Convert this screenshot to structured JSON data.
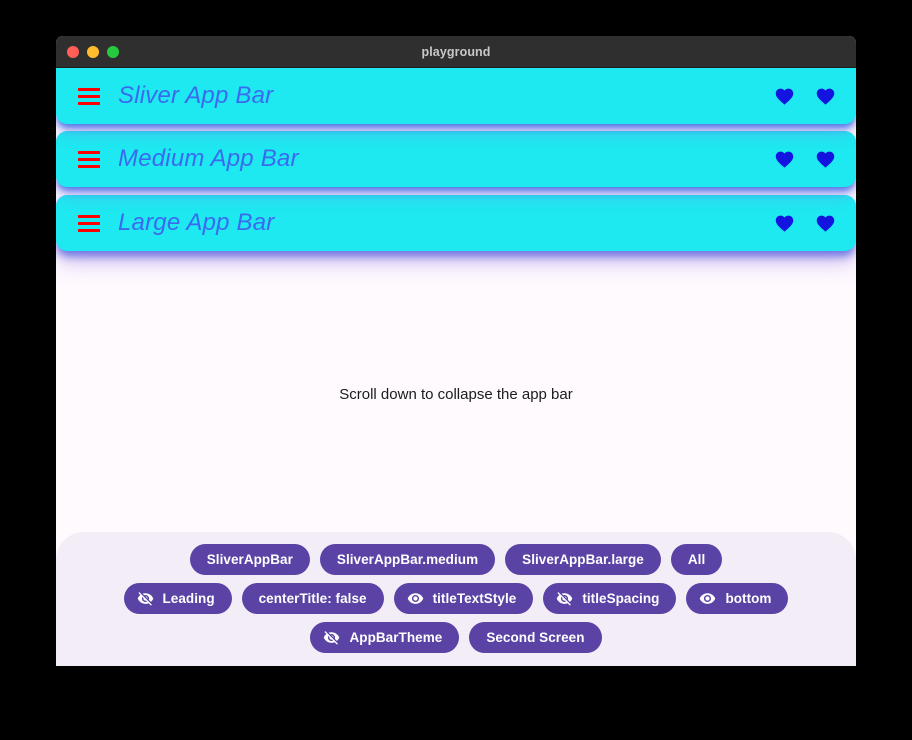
{
  "window": {
    "title": "playground",
    "traffic_lights": [
      "close-button",
      "minimize-button",
      "maximize-button"
    ],
    "colors": {
      "titlebar_bg": "#2F2F2F",
      "title_text": "#C9C9C9",
      "close": "#FF5F56",
      "minimize": "#FFBD2E",
      "maximize": "#27C93F"
    }
  },
  "appbars": [
    {
      "title": "Sliver App Bar",
      "leading_icon": "menu-icon",
      "actions": [
        "favorite-icon",
        "favorite-icon"
      ]
    },
    {
      "title": "Medium App Bar",
      "leading_icon": "menu-icon",
      "actions": [
        "favorite-icon",
        "favorite-icon"
      ]
    },
    {
      "title": "Large App Bar",
      "leading_icon": "menu-icon",
      "actions": [
        "favorite-icon",
        "favorite-icon"
      ]
    }
  ],
  "appbar_colors": {
    "background": "#1EE8F0",
    "title_text": "#3A6AF0",
    "leading_icon": "#FF0000",
    "action_icon": "#1414E0",
    "shadow": "#3A5AE6"
  },
  "body": {
    "hint": "Scroll down to collapse the app bar",
    "background": "#FEFAFE"
  },
  "controls": {
    "background": "#F3EDF7",
    "chip_background": "#5A43A5",
    "chip_text": "#FFFFFF",
    "rows": [
      [
        {
          "label": "SliverAppBar",
          "icon": null
        },
        {
          "label": "SliverAppBar.medium",
          "icon": null
        },
        {
          "label": "SliverAppBar.large",
          "icon": null
        },
        {
          "label": "All",
          "icon": null
        }
      ],
      [
        {
          "label": "Leading",
          "icon": "eye-off-icon"
        },
        {
          "label": "centerTitle: false",
          "icon": null
        },
        {
          "label": "titleTextStyle",
          "icon": "eye-icon"
        },
        {
          "label": "titleSpacing",
          "icon": "eye-off-icon"
        },
        {
          "label": "bottom",
          "icon": "eye-icon"
        }
      ],
      [
        {
          "label": "AppBarTheme",
          "icon": "eye-off-icon"
        },
        {
          "label": "Second Screen",
          "icon": null
        }
      ]
    ]
  }
}
